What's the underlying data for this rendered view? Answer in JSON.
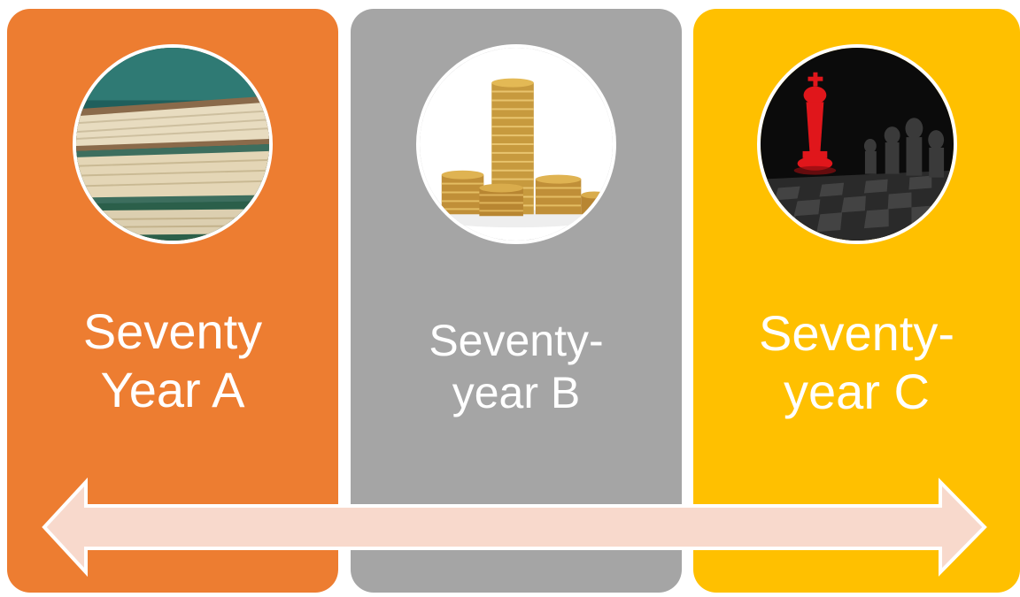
{
  "stages": [
    {
      "id": "a",
      "line1": "Seventy",
      "line2": "Year A",
      "color": "#ED7D31",
      "image": "books-stack-image"
    },
    {
      "id": "b",
      "line1": "Seventy-",
      "line2": "year B",
      "color": "#A5A5A5",
      "image": "coin-stacks-image"
    },
    {
      "id": "c",
      "line1": "Seventy-",
      "line2": "year C",
      "color": "#FFC000",
      "image": "chess-king-image"
    }
  ],
  "arrow": {
    "type": "double-headed",
    "fill": "#F8D9CC",
    "stroke": "#ffffff"
  }
}
